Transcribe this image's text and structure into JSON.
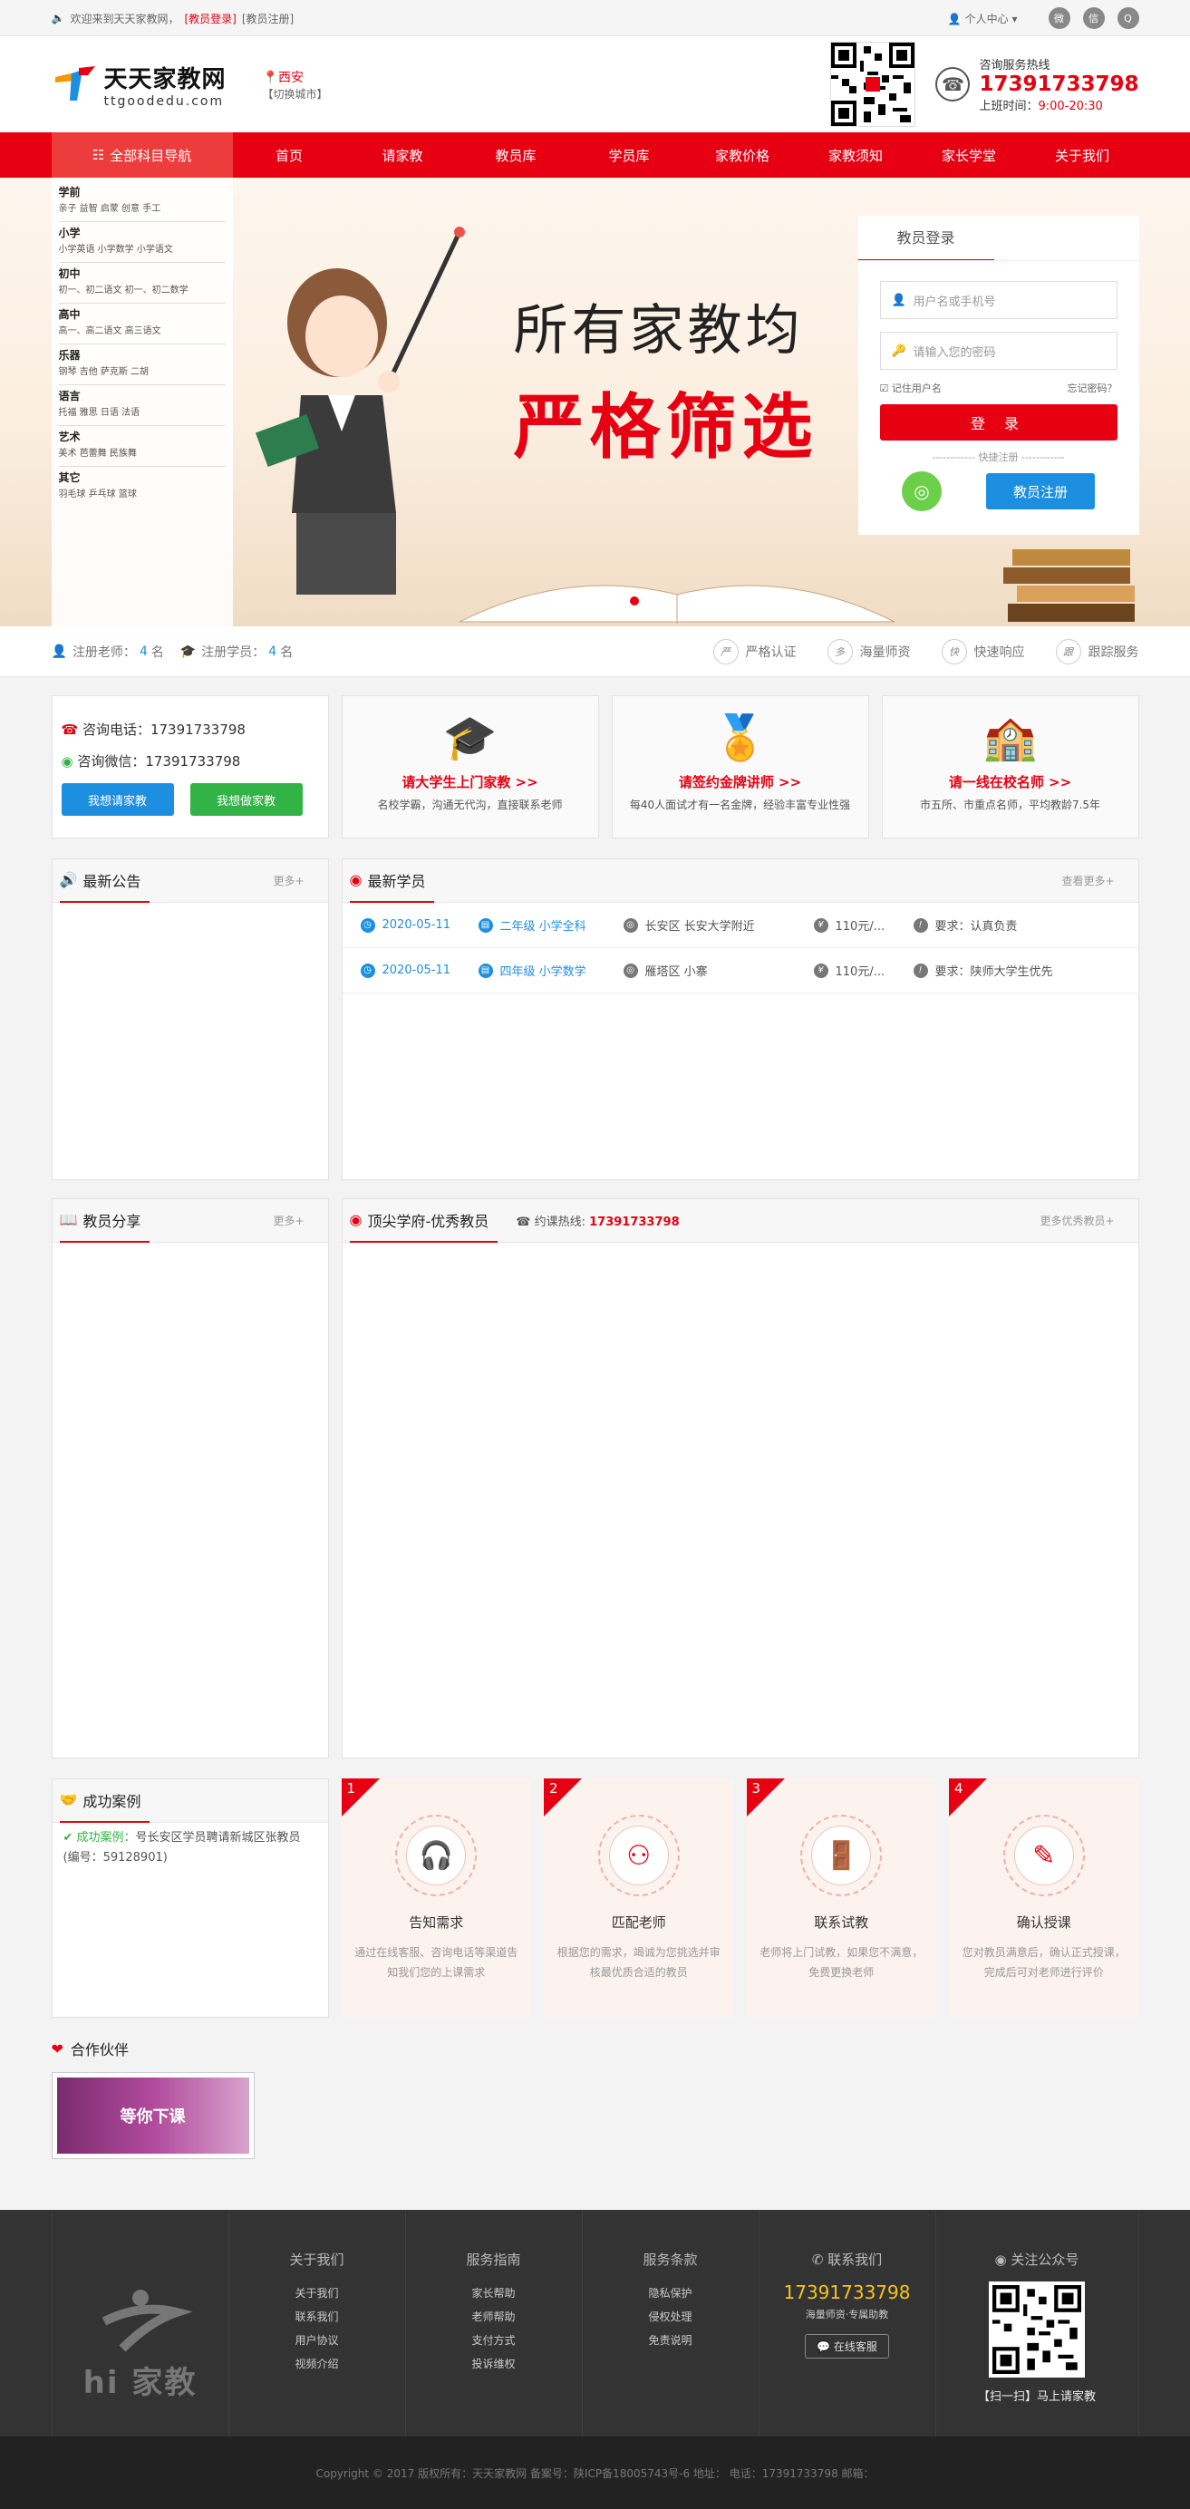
{
  "topbar": {
    "welcome": "欢迎来到天天家教网，",
    "teacher_login": "[教员登录]",
    "teacher_register": "[教员注册]",
    "personal_center": "个人中心"
  },
  "header": {
    "logo_title": "天天家教网",
    "logo_domain": "ttgoodedu.com",
    "city": "西安",
    "switch_city": "【切换城市】",
    "hotline_label": "咨询服务热线",
    "hotline_number": "17391733798",
    "hours_label": "上班时间：",
    "hours_value": "9:00-20:30"
  },
  "nav": {
    "category_label": "全部科目导航",
    "items": [
      "首页",
      "请家教",
      "教员库",
      "学员库",
      "家教价格",
      "家教须知",
      "家长学堂",
      "关于我们"
    ]
  },
  "sidebar": [
    {
      "group": "学前",
      "subs": "亲子  益智  启蒙  创意  手工"
    },
    {
      "group": "小学",
      "subs": "小学英语  小学数学  小学语文"
    },
    {
      "group": "初中",
      "subs": "初一、初二语文  初一、初二数学"
    },
    {
      "group": "高中",
      "subs": "高一、高二语文  高三语文"
    },
    {
      "group": "乐器",
      "subs": "钢琴  吉他  萨克斯  二胡"
    },
    {
      "group": "语言",
      "subs": "托福  雅思  日语  法语"
    },
    {
      "group": "艺术",
      "subs": "美术  芭蕾舞  民族舞"
    },
    {
      "group": "其它",
      "subs": "羽毛球  乒乓球  篮球"
    }
  ],
  "banner": {
    "line1": "所有家教均",
    "line2": "严格筛选"
  },
  "login": {
    "tab": "教员登录",
    "username_placeholder": "用户名或手机号",
    "password_placeholder": "请输入您的密码",
    "remember": "记住用户名",
    "forgot": "忘记密码？",
    "submit": "登 录",
    "quick": "快捷注册",
    "register": "教员注册"
  },
  "stats": {
    "teachers_label": "注册老师：",
    "teachers_count": "4",
    "students_label": "注册学员：",
    "students_count": "4",
    "unit": "名",
    "features": [
      {
        "mark": "严",
        "text": "严格认证"
      },
      {
        "mark": "多",
        "text": "海量师资"
      },
      {
        "mark": "快",
        "text": "快速响应"
      },
      {
        "mark": "跟",
        "text": "跟踪服务"
      }
    ]
  },
  "consult": {
    "phone": "咨询电话：17391733798",
    "wechat": "咨询微信：17391733798",
    "btn_hire": "我想请家教",
    "btn_tutor": "我想做家教"
  },
  "promos": [
    {
      "title": "请大学生上门家教 >>",
      "desc": "名校学霸，沟通无代沟，直接联系老师",
      "icon": "🎓"
    },
    {
      "title": "请签约金牌讲师 >>",
      "desc": "每40人面试才有一名金牌，经验丰富专业性强",
      "icon": "🏅"
    },
    {
      "title": "请一线在校名师 >>",
      "desc": "市五所、市重点名师，平均教龄7.5年",
      "icon": "🏫"
    }
  ],
  "notice": {
    "title": "最新公告",
    "more": "更多+"
  },
  "students": {
    "title": "最新学员",
    "more": "查看更多+",
    "rows": [
      {
        "date": "2020-05-11",
        "grade": "二年级 小学全科",
        "addr": "长安区 长安大学附近",
        "price": "110元/...",
        "req": "要求：认真负责"
      },
      {
        "date": "2020-05-11",
        "grade": "四年级 小学数学",
        "addr": "雁塔区 小寨",
        "price": "110元/...",
        "req": "要求：陕师大学生优先"
      }
    ]
  },
  "share": {
    "title": "教员分享",
    "more": "更多+"
  },
  "top_teachers": {
    "title": "顶尖学府-优秀教员",
    "hotline_label": "约课热线:",
    "hotline": "17391733798",
    "more": "更多优秀教员+"
  },
  "cases": {
    "title": "成功案例",
    "tag": "成功案例：",
    "text": "号长安区学员聘请新城区张教员(编号：59128901)"
  },
  "steps": [
    {
      "no": "1",
      "title": "告知需求",
      "desc": "通过在线客服、咨询电话等渠道告知我们您的上课需求"
    },
    {
      "no": "2",
      "title": "匹配老师",
      "desc": "根据您的需求，竭诚为您挑选并审核最优质合适的教员"
    },
    {
      "no": "3",
      "title": "联系试教",
      "desc": "老师将上门试教，如果您不满意，免费更换老师"
    },
    {
      "no": "4",
      "title": "确认授课",
      "desc": "您对教员满意后，确认正式授课，完成后可对老师进行评价"
    }
  ],
  "partners": {
    "title": "合作伙伴",
    "banner_text": "等你下课"
  },
  "footer": {
    "logo_text": "hi 家教",
    "cols": [
      {
        "title": "关于我们",
        "items": [
          "关于我们",
          "联系我们",
          "用户协议",
          "视频介绍"
        ]
      },
      {
        "title": "服务指南",
        "items": [
          "家长帮助",
          "老师帮助",
          "支付方式",
          "投诉维权"
        ]
      },
      {
        "title": "服务条款",
        "items": [
          "隐私保护",
          "侵权处理",
          "免责说明"
        ]
      }
    ],
    "contact_title": "联系我们",
    "contact_phone": "17391733798",
    "contact_note": "海量师资·专属助教",
    "online_service": "在线客服",
    "wechat_title": "关注公众号",
    "wechat_note": "【扫一扫】马上请家教",
    "copyright": "Copyright © 2017 版权所有：天天家教网     备案号：陕ICP备18005743号-6     地址：     电话：17391733798     邮箱："
  },
  "colors": {
    "brand": "#e60012",
    "blue": "#1d8fe0",
    "green": "#32b345"
  }
}
